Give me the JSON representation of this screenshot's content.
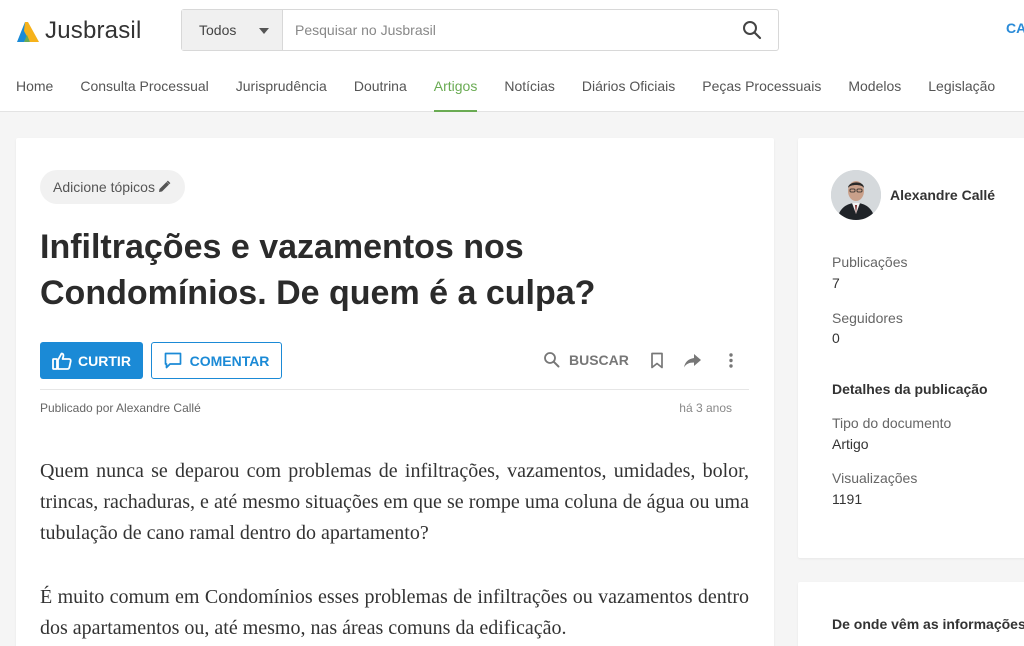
{
  "header": {
    "logo_text": "Jusbrasil",
    "search": {
      "category": "Todos",
      "placeholder": "Pesquisar no Jusbrasil"
    },
    "right_link": "CA",
    "nav": [
      {
        "label": "Home",
        "active": false
      },
      {
        "label": "Consulta Processual",
        "active": false
      },
      {
        "label": "Jurisprudência",
        "active": false
      },
      {
        "label": "Doutrina",
        "active": false
      },
      {
        "label": "Artigos",
        "active": true
      },
      {
        "label": "Notícias",
        "active": false
      },
      {
        "label": "Diários Oficiais",
        "active": false
      },
      {
        "label": "Peças Processuais",
        "active": false
      },
      {
        "label": "Modelos",
        "active": false
      },
      {
        "label": "Legislação",
        "active": false
      }
    ]
  },
  "article": {
    "topics_label": "Adicione tópicos",
    "title_line1": "Infiltrações e vazamentos nos",
    "title_line2": "Condomínios. De quem é a culpa?",
    "actions": {
      "like": "CURTIR",
      "comment": "COMENTAR",
      "search": "BUSCAR"
    },
    "published_by": "Publicado por Alexandre Callé",
    "time_ago": "há 3 anos",
    "paragraphs": [
      "Quem nunca se deparou com problemas de infiltrações, vazamentos, umidades, bolor, trincas, rachaduras, e até mesmo situações em que se rompe uma coluna de água ou uma tubulação de cano ramal dentro do apartamento?",
      "É muito comum em Condomínios esses problemas de infiltrações ou vazamentos dentro dos apartamentos ou, até mesmo, nas áreas comuns da edificação."
    ]
  },
  "sidebar": {
    "author": "Alexandre Callé",
    "publications_label": "Publicações",
    "publications_value": "7",
    "followers_label": "Seguidores",
    "followers_value": "0",
    "details_heading": "Detalhes da publicação",
    "doc_type_label": "Tipo do documento",
    "doc_type_value": "Artigo",
    "views_label": "Visualizações",
    "views_value": "1191",
    "info_heading": "De onde vêm as informações"
  },
  "colors": {
    "brand_green": "#6aab53",
    "primary_blue": "#1b8ad6"
  },
  "icons": [
    "logo-mark-icon",
    "chevron-down-icon",
    "search-icon",
    "pencil-icon",
    "thumbs-up-icon",
    "comment-icon",
    "bookmark-icon",
    "share-icon",
    "more-vertical-icon"
  ]
}
